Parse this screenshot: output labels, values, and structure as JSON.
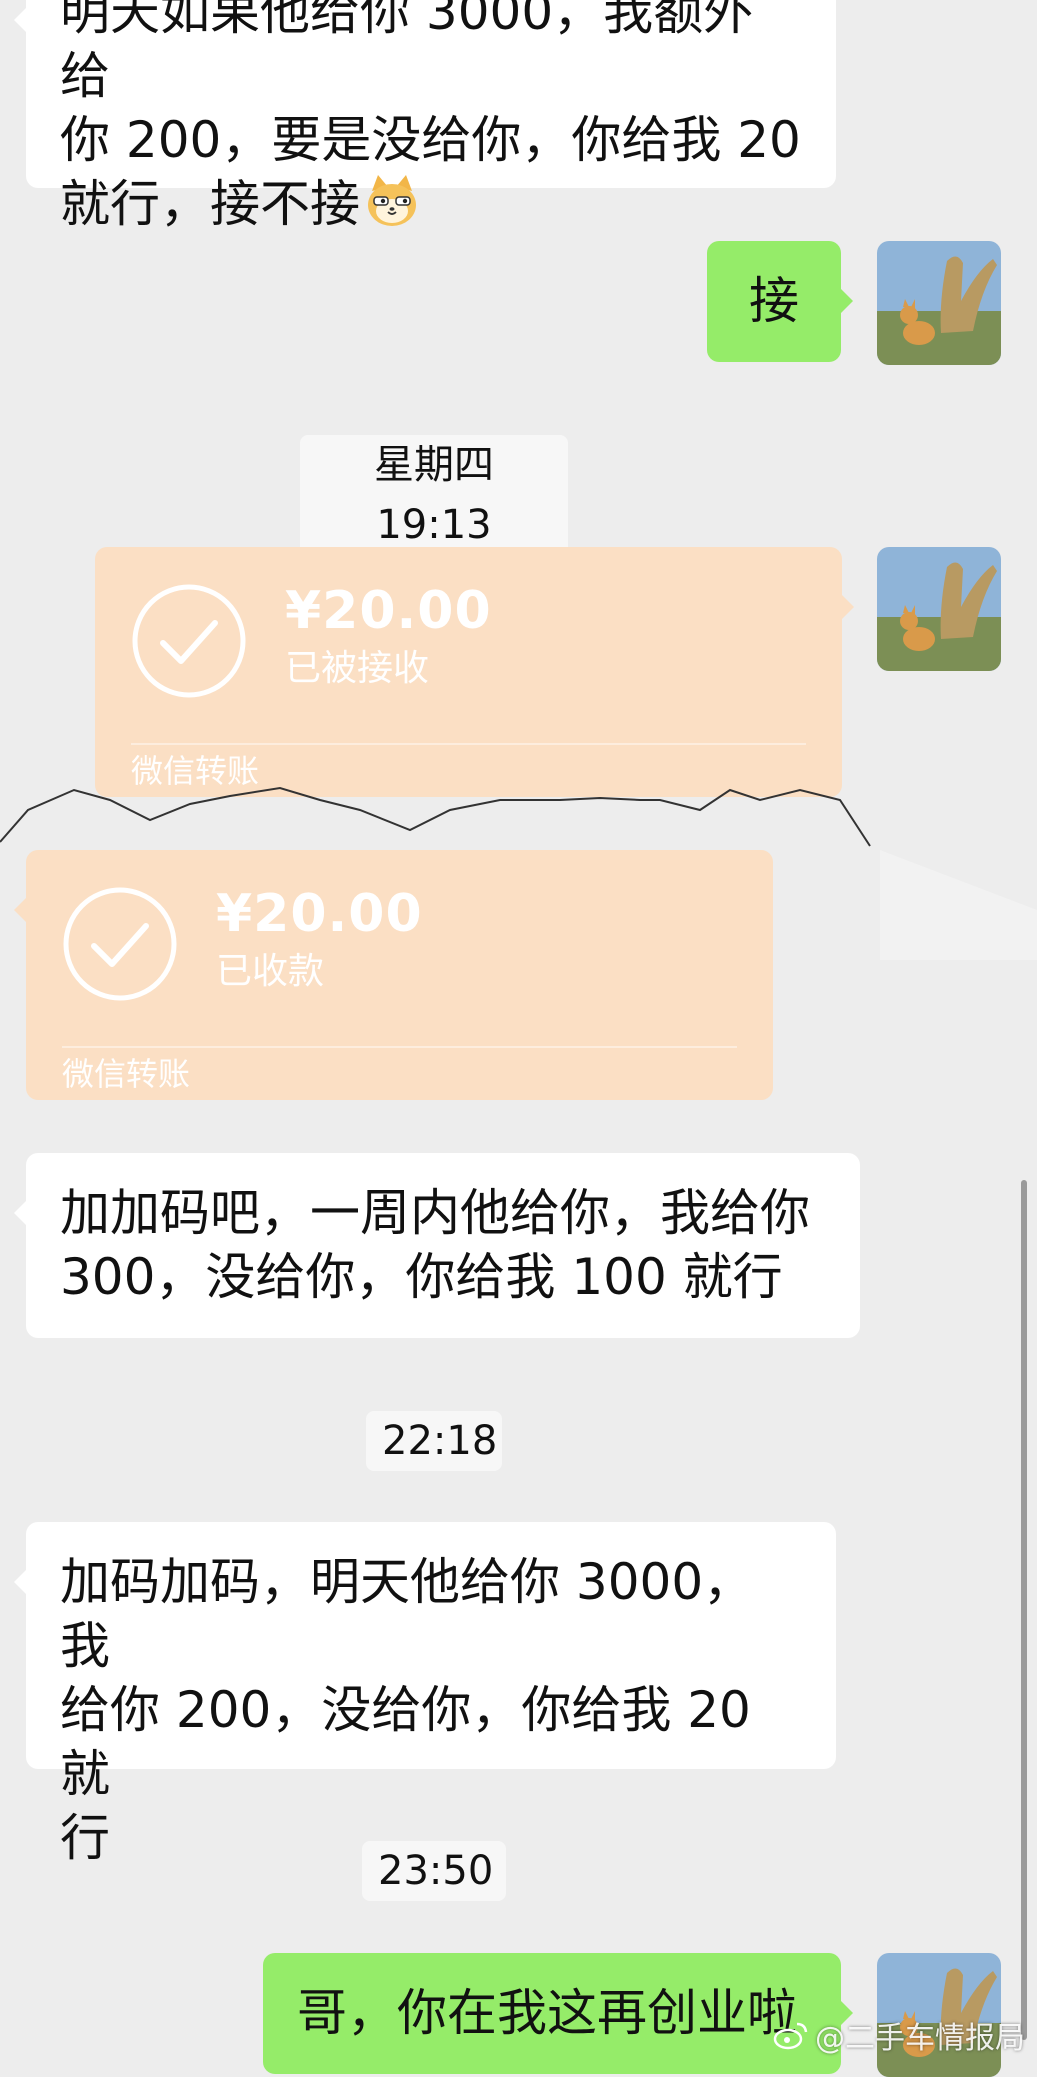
{
  "messages": {
    "m1": {
      "line1": "明天如果他给你 3000，我额外给",
      "line2": "你 200，要是没给你，你给我 20",
      "line3": "就行，接不接"
    },
    "m2": "接",
    "stamp1": "星期四 19:13",
    "transfer_out": {
      "amount": "¥20.00",
      "status": "已被接收",
      "caption": "微信转账"
    },
    "transfer_in": {
      "amount": "¥20.00",
      "status": "已收款",
      "caption": "微信转账"
    },
    "m3": {
      "line1": "加加码吧，一周内他给你，我给你",
      "line2": "300，没给你，你给我 100 就行"
    },
    "stamp2": "22:18",
    "m4": {
      "line1": "加码加码，明天他给你 3000，我",
      "line2": "给你 200，没给你，你给我 20 就",
      "line3": "行"
    },
    "stamp3": "23:50",
    "m5": "哥，你在我这再创业啦"
  },
  "watermark": {
    "text": "@二手车情报局",
    "icon": "weibo-icon"
  },
  "colors": {
    "background": "#ededed",
    "incoming_bubble": "#ffffff",
    "outgoing_bubble": "#95ec69",
    "transfer_card": "#fbdfc4"
  }
}
